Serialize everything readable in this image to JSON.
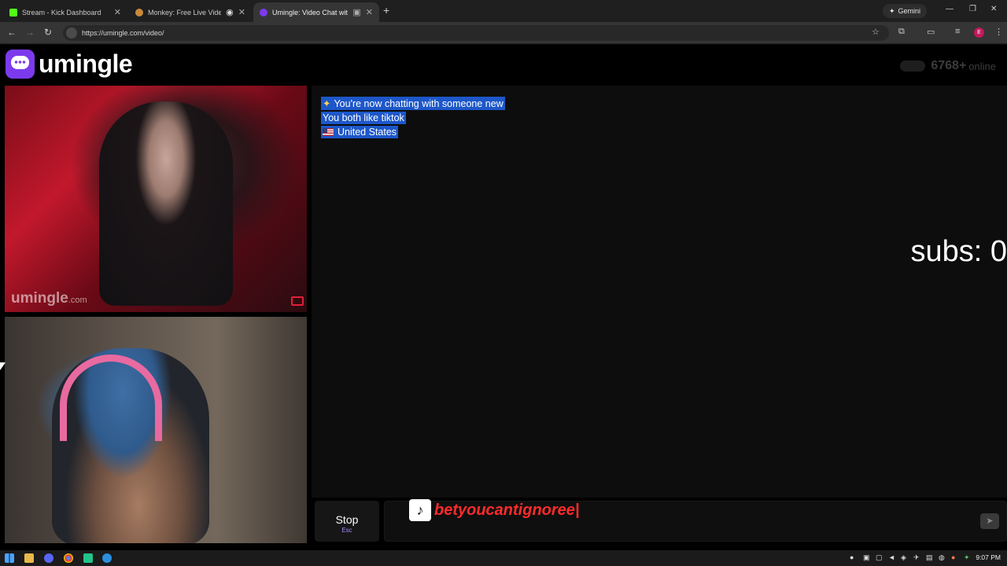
{
  "browser": {
    "tabs": [
      {
        "title": "Stream - Kick Dashboard",
        "fav_color": "#53fc18",
        "active": false
      },
      {
        "title": "Monkey: Free Live Video Ch",
        "fav_color": "#c98a3a",
        "active": false
      },
      {
        "title": "Umingle: Video Chat with S",
        "fav_color": "#7c3aed",
        "active": true
      }
    ],
    "new_tab_label": "+",
    "gemini_label": "Gemini",
    "url": "https://umingle.com/video/",
    "profile_initial": "E"
  },
  "site": {
    "logo_text": "umingle",
    "online_count": "6768+",
    "online_label": "online"
  },
  "videos": {
    "watermark": "umingle",
    "watermark_suffix": ".com"
  },
  "chat": {
    "messages": [
      {
        "icon": "sparkle-icon",
        "text": "You're now chatting with someone new"
      },
      {
        "text": "You both like tiktok"
      },
      {
        "icon": "us-flag-icon",
        "text": "United States"
      }
    ],
    "overlay_subs": "subs: 0"
  },
  "controls": {
    "stop_label": "Stop",
    "stop_key": "Esc",
    "message_value": "",
    "send_icon": "send-icon"
  },
  "stream_overlay": {
    "platform_icon": "tiktok-icon",
    "handle": "betyoucantignoree|"
  },
  "taskbar": {
    "time": "9:07 PM"
  }
}
